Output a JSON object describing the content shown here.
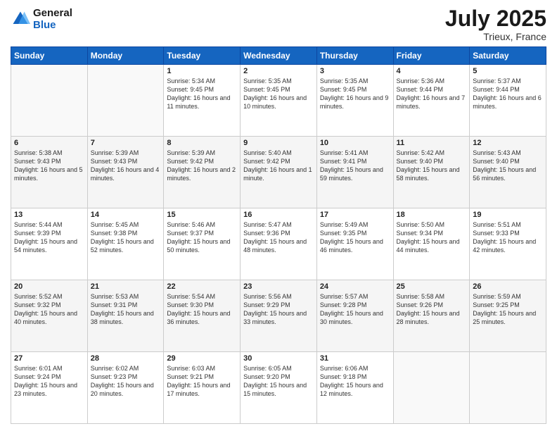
{
  "header": {
    "logo_line1": "General",
    "logo_line2": "Blue",
    "month": "July 2025",
    "location": "Trieux, France"
  },
  "days_of_week": [
    "Sunday",
    "Monday",
    "Tuesday",
    "Wednesday",
    "Thursday",
    "Friday",
    "Saturday"
  ],
  "weeks": [
    [
      {
        "day": "",
        "info": ""
      },
      {
        "day": "",
        "info": ""
      },
      {
        "day": "1",
        "info": "Sunrise: 5:34 AM\nSunset: 9:45 PM\nDaylight: 16 hours and 11 minutes."
      },
      {
        "day": "2",
        "info": "Sunrise: 5:35 AM\nSunset: 9:45 PM\nDaylight: 16 hours and 10 minutes."
      },
      {
        "day": "3",
        "info": "Sunrise: 5:35 AM\nSunset: 9:45 PM\nDaylight: 16 hours and 9 minutes."
      },
      {
        "day": "4",
        "info": "Sunrise: 5:36 AM\nSunset: 9:44 PM\nDaylight: 16 hours and 7 minutes."
      },
      {
        "day": "5",
        "info": "Sunrise: 5:37 AM\nSunset: 9:44 PM\nDaylight: 16 hours and 6 minutes."
      }
    ],
    [
      {
        "day": "6",
        "info": "Sunrise: 5:38 AM\nSunset: 9:43 PM\nDaylight: 16 hours and 5 minutes."
      },
      {
        "day": "7",
        "info": "Sunrise: 5:39 AM\nSunset: 9:43 PM\nDaylight: 16 hours and 4 minutes."
      },
      {
        "day": "8",
        "info": "Sunrise: 5:39 AM\nSunset: 9:42 PM\nDaylight: 16 hours and 2 minutes."
      },
      {
        "day": "9",
        "info": "Sunrise: 5:40 AM\nSunset: 9:42 PM\nDaylight: 16 hours and 1 minute."
      },
      {
        "day": "10",
        "info": "Sunrise: 5:41 AM\nSunset: 9:41 PM\nDaylight: 15 hours and 59 minutes."
      },
      {
        "day": "11",
        "info": "Sunrise: 5:42 AM\nSunset: 9:40 PM\nDaylight: 15 hours and 58 minutes."
      },
      {
        "day": "12",
        "info": "Sunrise: 5:43 AM\nSunset: 9:40 PM\nDaylight: 15 hours and 56 minutes."
      }
    ],
    [
      {
        "day": "13",
        "info": "Sunrise: 5:44 AM\nSunset: 9:39 PM\nDaylight: 15 hours and 54 minutes."
      },
      {
        "day": "14",
        "info": "Sunrise: 5:45 AM\nSunset: 9:38 PM\nDaylight: 15 hours and 52 minutes."
      },
      {
        "day": "15",
        "info": "Sunrise: 5:46 AM\nSunset: 9:37 PM\nDaylight: 15 hours and 50 minutes."
      },
      {
        "day": "16",
        "info": "Sunrise: 5:47 AM\nSunset: 9:36 PM\nDaylight: 15 hours and 48 minutes."
      },
      {
        "day": "17",
        "info": "Sunrise: 5:49 AM\nSunset: 9:35 PM\nDaylight: 15 hours and 46 minutes."
      },
      {
        "day": "18",
        "info": "Sunrise: 5:50 AM\nSunset: 9:34 PM\nDaylight: 15 hours and 44 minutes."
      },
      {
        "day": "19",
        "info": "Sunrise: 5:51 AM\nSunset: 9:33 PM\nDaylight: 15 hours and 42 minutes."
      }
    ],
    [
      {
        "day": "20",
        "info": "Sunrise: 5:52 AM\nSunset: 9:32 PM\nDaylight: 15 hours and 40 minutes."
      },
      {
        "day": "21",
        "info": "Sunrise: 5:53 AM\nSunset: 9:31 PM\nDaylight: 15 hours and 38 minutes."
      },
      {
        "day": "22",
        "info": "Sunrise: 5:54 AM\nSunset: 9:30 PM\nDaylight: 15 hours and 36 minutes."
      },
      {
        "day": "23",
        "info": "Sunrise: 5:56 AM\nSunset: 9:29 PM\nDaylight: 15 hours and 33 minutes."
      },
      {
        "day": "24",
        "info": "Sunrise: 5:57 AM\nSunset: 9:28 PM\nDaylight: 15 hours and 30 minutes."
      },
      {
        "day": "25",
        "info": "Sunrise: 5:58 AM\nSunset: 9:26 PM\nDaylight: 15 hours and 28 minutes."
      },
      {
        "day": "26",
        "info": "Sunrise: 5:59 AM\nSunset: 9:25 PM\nDaylight: 15 hours and 25 minutes."
      }
    ],
    [
      {
        "day": "27",
        "info": "Sunrise: 6:01 AM\nSunset: 9:24 PM\nDaylight: 15 hours and 23 minutes."
      },
      {
        "day": "28",
        "info": "Sunrise: 6:02 AM\nSunset: 9:23 PM\nDaylight: 15 hours and 20 minutes."
      },
      {
        "day": "29",
        "info": "Sunrise: 6:03 AM\nSunset: 9:21 PM\nDaylight: 15 hours and 17 minutes."
      },
      {
        "day": "30",
        "info": "Sunrise: 6:05 AM\nSunset: 9:20 PM\nDaylight: 15 hours and 15 minutes."
      },
      {
        "day": "31",
        "info": "Sunrise: 6:06 AM\nSunset: 9:18 PM\nDaylight: 15 hours and 12 minutes."
      },
      {
        "day": "",
        "info": ""
      },
      {
        "day": "",
        "info": ""
      }
    ]
  ]
}
